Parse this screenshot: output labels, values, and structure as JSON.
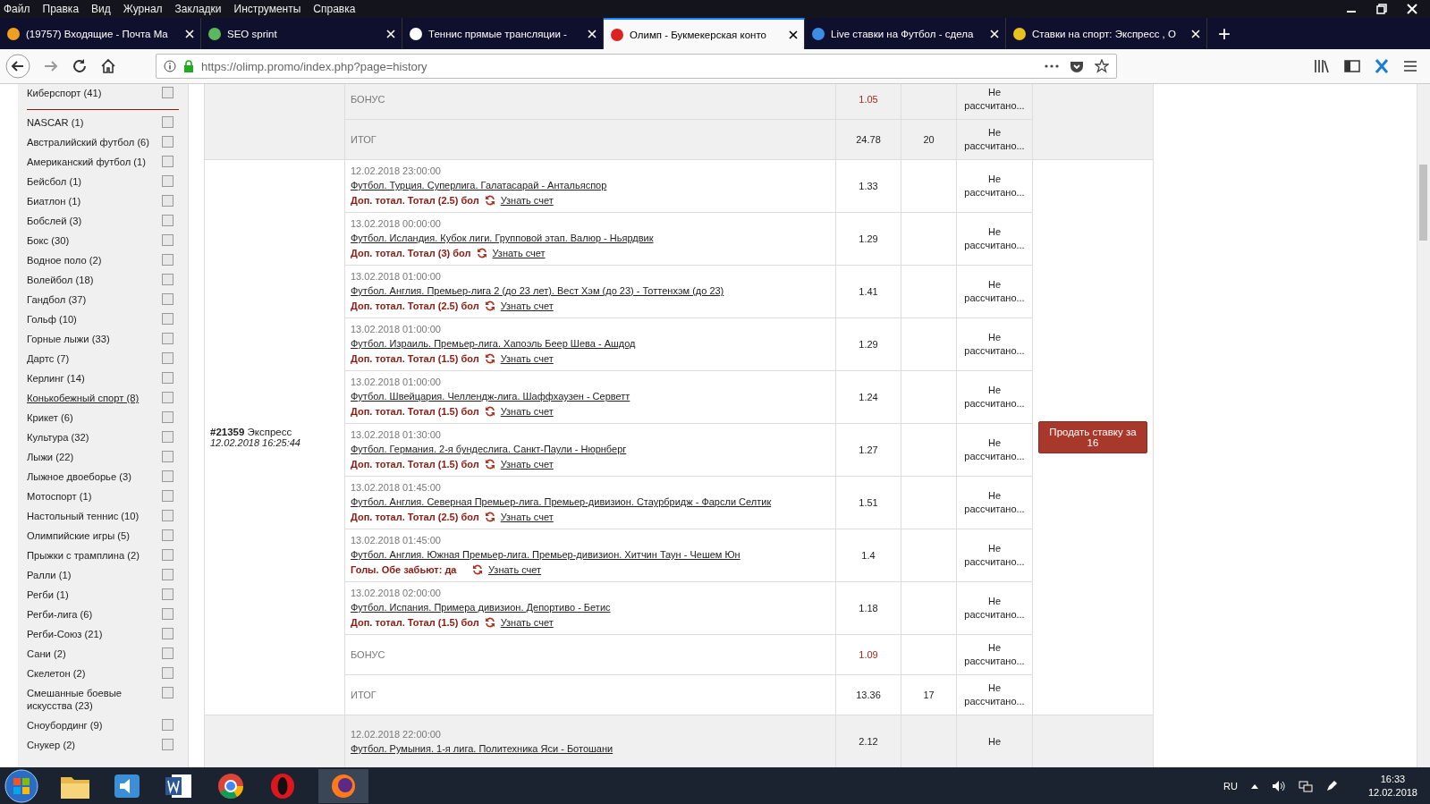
{
  "menu_bar": [
    "Файл",
    "Правка",
    "Вид",
    "Журнал",
    "Закладки",
    "Инструменты",
    "Справка"
  ],
  "tabs": [
    {
      "label": "(19757) Входящие - Почта Ma",
      "selected": false
    },
    {
      "label": "SEO sprint",
      "selected": false
    },
    {
      "label": "Теннис прямые трансляции -",
      "selected": false
    },
    {
      "label": "Олимп - Букмекерская конто",
      "selected": true
    },
    {
      "label": "Live ставки на Футбол - сдела",
      "selected": false
    },
    {
      "label": "Ставки на спорт: Экспресс , О",
      "selected": false
    }
  ],
  "new_tab": "+",
  "address": {
    "host": "https://olimp.promo",
    "path": "/index.php?page=history"
  },
  "sports_filter": [
    {
      "label": "Киберспорт (41)",
      "checked": false,
      "hovered": false
    },
    {
      "kind": "divider"
    },
    {
      "label": "NASCAR (1)",
      "checked": false,
      "hovered": false
    },
    {
      "label": "Австралийский футбол (6)",
      "checked": false,
      "hovered": false
    },
    {
      "label": "Американский футбол (1)",
      "checked": false,
      "hovered": false
    },
    {
      "label": "Бейсбол (1)",
      "checked": false,
      "hovered": false
    },
    {
      "label": "Биатлон (1)",
      "checked": false,
      "hovered": false
    },
    {
      "label": "Бобслей (3)",
      "checked": false,
      "hovered": false
    },
    {
      "label": "Бокс (30)",
      "checked": false,
      "hovered": false
    },
    {
      "label": "Водное поло (2)",
      "checked": false,
      "hovered": false
    },
    {
      "label": "Волейбол (18)",
      "checked": false,
      "hovered": false
    },
    {
      "label": "Гандбол (37)",
      "checked": false,
      "hovered": false
    },
    {
      "label": "Гольф (10)",
      "checked": false,
      "hovered": false
    },
    {
      "label": "Горные лыжи (33)",
      "checked": false,
      "hovered": false
    },
    {
      "label": "Дартс (7)",
      "checked": false,
      "hovered": false
    },
    {
      "label": "Керлинг (14)",
      "checked": false,
      "hovered": false
    },
    {
      "label": "Конькобежный спорт (8)",
      "checked": false,
      "hovered": true
    },
    {
      "label": "Крикет (6)",
      "checked": false,
      "hovered": false
    },
    {
      "label": "Культура (32)",
      "checked": false,
      "hovered": false
    },
    {
      "label": "Лыжи (22)",
      "checked": false,
      "hovered": false
    },
    {
      "label": "Лыжное двоеборье (3)",
      "checked": false,
      "hovered": false
    },
    {
      "label": "Мотоспорт (1)",
      "checked": false,
      "hovered": false
    },
    {
      "label": "Настольный теннис (10)",
      "checked": false,
      "hovered": false
    },
    {
      "label": "Олимпийские игры (5)",
      "checked": false,
      "hovered": false
    },
    {
      "label": "Прыжки с трамплина (2)",
      "checked": false,
      "hovered": false
    },
    {
      "label": "Ралли (1)",
      "checked": false,
      "hovered": false
    },
    {
      "label": "Регби (1)",
      "checked": false,
      "hovered": false
    },
    {
      "label": "Регби-лига (6)",
      "checked": false,
      "hovered": false
    },
    {
      "label": "Регби-Союз (21)",
      "checked": false,
      "hovered": false
    },
    {
      "label": "Сани (2)",
      "checked": false,
      "hovered": false
    },
    {
      "label": "Скелетон (2)",
      "checked": false,
      "hovered": false
    },
    {
      "label": "Смешанные боевые искусства (23)",
      "checked": false,
      "hovered": false
    },
    {
      "label": "Сноубординг (9)",
      "checked": false,
      "hovered": false
    },
    {
      "label": "Снукер (2)",
      "checked": false,
      "hovered": false
    }
  ],
  "bets": [
    {
      "shaded": true,
      "rows": [
        {
          "kind": "bonus",
          "label": "БОНУС",
          "odds": "1.05",
          "status": "Не рассчитано..."
        },
        {
          "kind": "total",
          "label": "ИТОГ",
          "odds": "24.78",
          "stake": "20",
          "status": "Не рассчитано..."
        }
      ]
    },
    {
      "shaded": false,
      "number": "#21359",
      "type": "Экспресс",
      "date": "12.02.2018 16:25:44",
      "sell_button": "Продать ставку за 16",
      "rows": [
        {
          "kind": "event",
          "date": "12.02.2018 23:00:00",
          "match": "Футбол. Турция. Суперлига. Галатасарай - Антальяспор",
          "market": "Доп. тотал. Тотал (2.5) бол",
          "score_link": "Узнать счет",
          "odds": "1.33",
          "status": "Не рассчитано..."
        },
        {
          "kind": "event",
          "date": "13.02.2018 00:00:00",
          "match": "Футбол. Исландия. Кубок лиги. Групповой этап. Валюр - Ньярдвик",
          "market": "Доп. тотал. Тотал (3) бол",
          "score_link": "Узнать счет",
          "odds": "1.29",
          "status": "Не рассчитано..."
        },
        {
          "kind": "event",
          "date": "13.02.2018 01:00:00",
          "match": "Футбол. Англия. Премьер-лига 2 (до 23 лет). Вест Хэм (до 23) - Тоттенхэм (до 23)",
          "market": "Доп. тотал. Тотал (2.5) бол",
          "score_link": "Узнать счет",
          "odds": "1.41",
          "status": "Не рассчитано..."
        },
        {
          "kind": "event",
          "date": "13.02.2018 01:00:00",
          "match": "Футбол. Израиль. Премьер-лига. Хапоэль Беер Шева - Ашдод",
          "market": "Доп. тотал. Тотал (1.5) бол",
          "score_link": "Узнать счет",
          "odds": "1.29",
          "status": "Не рассчитано..."
        },
        {
          "kind": "event",
          "date": "13.02.2018 01:00:00",
          "match": "Футбол. Швейцария. Челлендж-лига. Шаффхаузен - Серветт",
          "market": "Доп. тотал. Тотал (1.5) бол",
          "score_link": "Узнать счет",
          "odds": "1.24",
          "status": "Не рассчитано..."
        },
        {
          "kind": "event",
          "date": "13.02.2018 01:30:00",
          "match": "Футбол. Германия. 2-я бундеслига. Санкт-Паули - Нюрнберг",
          "market": "Доп. тотал. Тотал (1.5) бол",
          "score_link": "Узнать счет",
          "odds": "1.27",
          "status": "Не рассчитано..."
        },
        {
          "kind": "event",
          "date": "13.02.2018 01:45:00",
          "match": "Футбол. Англия. Северная Премьер-лига. Премьер-дивизион. Стаурбридж - Фарсли Селтик",
          "market": "Доп. тотал. Тотал (2.5) бол",
          "score_link": "Узнать счет",
          "odds": "1.51",
          "status": "Не рассчитано..."
        },
        {
          "kind": "event",
          "date": "13.02.2018 01:45:00",
          "match": "Футбол. Англия. Южная Премьер-лига. Премьер-дивизион. Хитчин Таун - Чешем Юн",
          "market": "Голы. Обе забьют: да",
          "score_link": "Узнать счет",
          "odds": "1.4",
          "status": "Не рассчитано..."
        },
        {
          "kind": "event",
          "date": "13.02.2018 02:00:00",
          "match": "Футбол. Испания. Примера дивизион. Депортиво - Бетис",
          "market": "Доп. тотал. Тотал (1.5) бол",
          "score_link": "Узнать счет",
          "odds": "1.18",
          "status": "Не рассчитано..."
        },
        {
          "kind": "bonus",
          "label": "БОНУС",
          "odds": "1.09",
          "status": "Не рассчитано..."
        },
        {
          "kind": "total",
          "label": "ИТОГ",
          "odds": "13.36",
          "stake": "17",
          "status": "Не рассчитано..."
        }
      ]
    },
    {
      "shaded": true,
      "rows": [
        {
          "kind": "event",
          "date": "12.02.2018 22:00:00",
          "match": "Футбол. Румыния. 1-я лига. Политехника Яси - Ботошани",
          "odds": "2.12",
          "status": "Не"
        }
      ]
    }
  ],
  "taskbar": {
    "language": "RU",
    "time": "16:33",
    "date": "12.02.2018"
  }
}
